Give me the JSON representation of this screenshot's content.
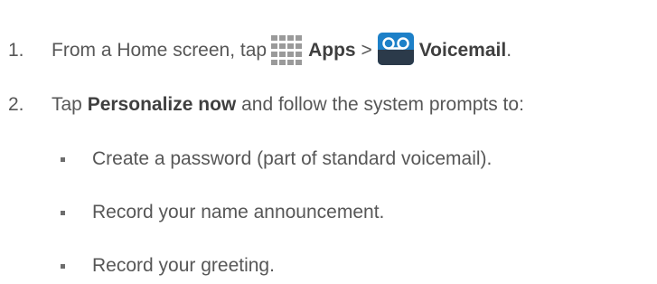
{
  "steps": [
    {
      "number": "1.",
      "text_before": "From a Home screen, tap",
      "apps_label": "Apps",
      "separator": ">",
      "voicemail_label": "Voicemail",
      "end": ".",
      "icons": [
        "apps-grid-icon",
        "voicemail-icon"
      ]
    },
    {
      "number": "2.",
      "text_before": "Tap",
      "bold_label": "Personalize now",
      "text_after": "and follow the system prompts to:",
      "sub_items": [
        "Create a password (part of standard voicemail).",
        "Record your name announcement.",
        "Record your greeting."
      ]
    }
  ],
  "colors": {
    "text": "#575757",
    "bold_text": "#3f3f3f",
    "voicemail_icon_blue": "#1d80c8"
  }
}
